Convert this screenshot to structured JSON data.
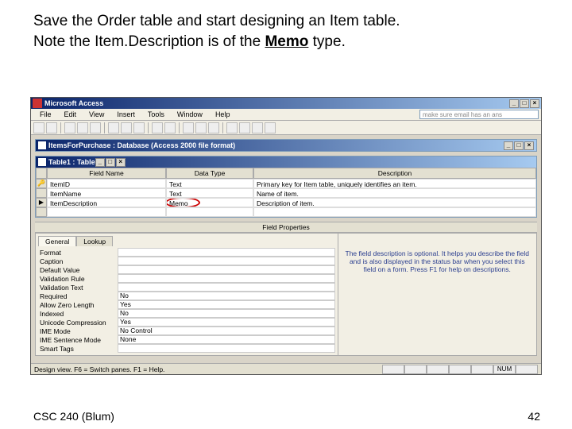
{
  "slideText": {
    "line1": "Save the Order table and start designing an Item table.",
    "line2a": "Note the Item.Description is of the ",
    "line2b": "Memo",
    "line2c": " type."
  },
  "titlebar": {
    "app": "Microsoft Access"
  },
  "menubar": {
    "items": [
      "File",
      "Edit",
      "View",
      "Insert",
      "Tools",
      "Window",
      "Help"
    ],
    "helpPlaceholder": "make sure email has an ans"
  },
  "dbwin": {
    "title": "ItemsForPurchase : Database (Access 2000 file format)"
  },
  "tblwin": {
    "title": "Table1 : Table"
  },
  "grid": {
    "headers": [
      "Field Name",
      "Data Type",
      "Description"
    ],
    "rows": [
      {
        "name": "ItemID",
        "type": "Text",
        "desc": "Primary key for Item table, uniquely identifies an item."
      },
      {
        "name": "ItemName",
        "type": "Text",
        "desc": "Name of item."
      },
      {
        "name": "ItemDescription",
        "type": "Memo",
        "desc": "Description of item."
      }
    ]
  },
  "fieldPropsLabel": "Field Properties",
  "tabs": {
    "general": "General",
    "lookup": "Lookup"
  },
  "props": [
    {
      "label": "Format",
      "value": ""
    },
    {
      "label": "Caption",
      "value": ""
    },
    {
      "label": "Default Value",
      "value": ""
    },
    {
      "label": "Validation Rule",
      "value": ""
    },
    {
      "label": "Validation Text",
      "value": ""
    },
    {
      "label": "Required",
      "value": "No"
    },
    {
      "label": "Allow Zero Length",
      "value": "Yes"
    },
    {
      "label": "Indexed",
      "value": "No"
    },
    {
      "label": "Unicode Compression",
      "value": "Yes"
    },
    {
      "label": "IME Mode",
      "value": "No Control"
    },
    {
      "label": "IME Sentence Mode",
      "value": "None"
    },
    {
      "label": "Smart Tags",
      "value": ""
    }
  ],
  "helpText": "The field description is optional. It helps you describe the field and is also displayed in the status bar when you select this field on a form. Press F1 for help on descriptions.",
  "statusbar": {
    "text": "Design view.  F6 = Switch panes.  F1 = Help.",
    "num": "NUM"
  },
  "footer": {
    "left": "CSC 240 (Blum)",
    "right": "42"
  }
}
